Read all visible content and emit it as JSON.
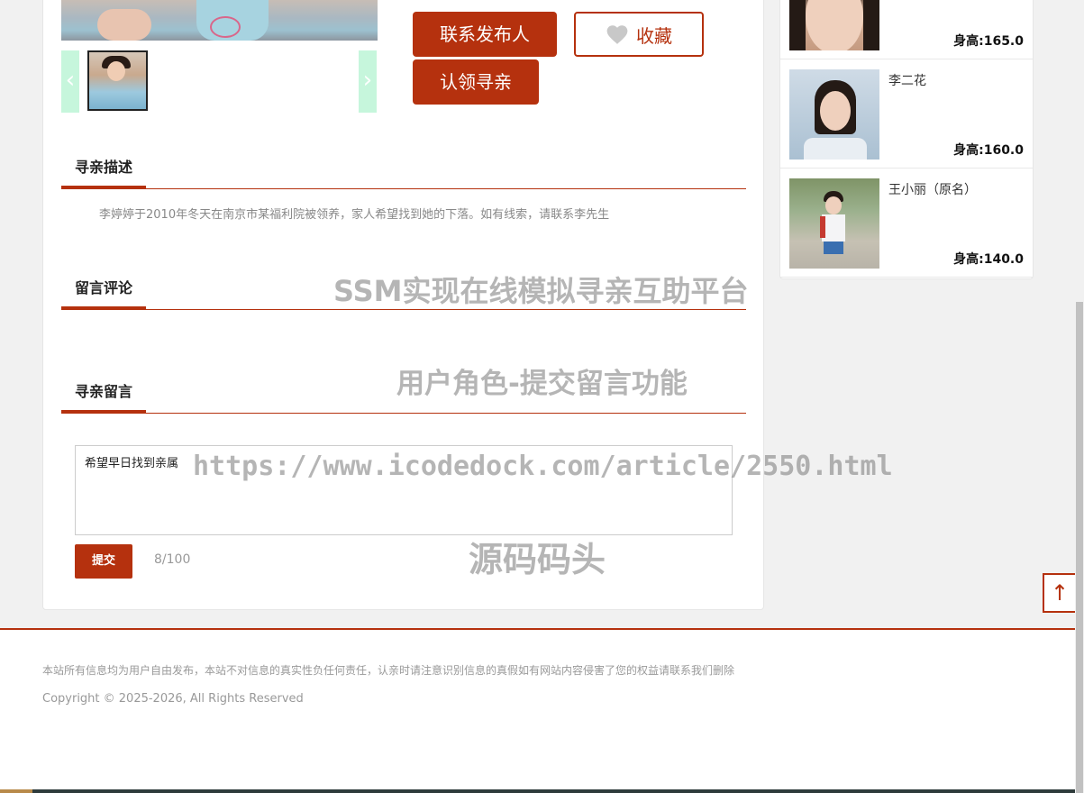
{
  "detail": {
    "contact_button": "联系发布人",
    "favorite_button": "收藏",
    "claim_button": "认领寻亲",
    "thumb_prev": "‹",
    "thumb_next": "›"
  },
  "sections": {
    "description_title": "寻亲描述",
    "description_text": "李婷婷于2010年冬天在南京市某福利院被领养，家人希望找到她的下落。如有线索，请联系李先生",
    "comments_title": "留言评论",
    "message_title": "寻亲留言"
  },
  "message_form": {
    "input_value": "希望早日找到亲属",
    "submit_label": "提交",
    "char_count": "8/100"
  },
  "sidebar": {
    "items": [
      {
        "name": "",
        "height": "身高:165.0"
      },
      {
        "name": "李二花",
        "height": "身高:160.0"
      },
      {
        "name": "王小丽（原名）",
        "height": "身高:140.0"
      }
    ]
  },
  "watermarks": {
    "line1": "SSM实现在线模拟寻亲互助平台",
    "line2": "用户角色-提交留言功能",
    "line3": "https://www.icodedock.com/article/2550.html",
    "line4": "源码码头"
  },
  "footer": {
    "disclaimer": "本站所有信息均为用户自由发布，本站不对信息的真实性负任何责任，认亲时请注意识别信息的真假如有网站内容侵害了您的权益请联系我们删除",
    "copyright": "Copyright © 2025-2026, All Rights Reserved"
  },
  "back_to_top": "↑",
  "colors": {
    "accent": "#b5310e",
    "page_bg": "#f1f1f1"
  }
}
